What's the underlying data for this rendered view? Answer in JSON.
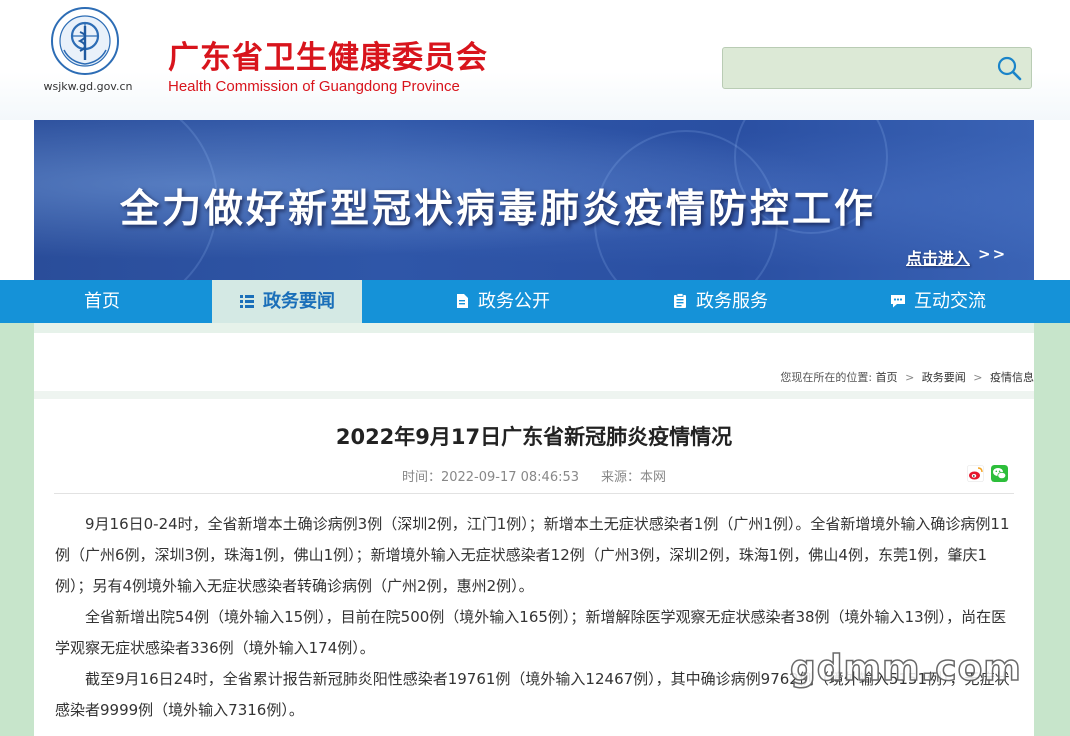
{
  "header": {
    "logo_url": "wsjkw.gd.gov.cn",
    "title_zh": "广东省卫生健康委员会",
    "title_en": "Health Commission of Guangdong Province",
    "search": {
      "placeholder": "",
      "value": ""
    }
  },
  "banner": {
    "title": "全力做好新型冠状病毒肺炎疫情防控工作",
    "link_label": "点击进入",
    "link_arrows": ">>"
  },
  "nav": {
    "items": [
      {
        "label": "首页",
        "icon": "none",
        "active": false
      },
      {
        "label": "政务要闻",
        "icon": "news-list-icon",
        "active": true
      },
      {
        "label": "政务公开",
        "icon": "document-icon",
        "active": false
      },
      {
        "label": "政务服务",
        "icon": "clipboard-icon",
        "active": false
      },
      {
        "label": "互动交流",
        "icon": "chat-icon",
        "active": false
      }
    ]
  },
  "breadcrumb": {
    "prefix": "您现在所在的位置:",
    "items": [
      "首页",
      "政务要闻",
      "疫情信息"
    ],
    "separator": ">"
  },
  "article": {
    "title": "2022年9月17日广东省新冠肺炎疫情情况",
    "time_label": "时间：",
    "time": "2022-09-17 08:46:53",
    "source_label": "来源：",
    "source": "本网",
    "paragraphs": [
      "9月16日0-24时，全省新增本土确诊病例3例（深圳2例，江门1例）；新增本土无症状感染者1例（广州1例）。全省新增境外输入确诊病例11例（广州6例，深圳3例，珠海1例，佛山1例）；新增境外输入无症状感染者12例（广州3例，深圳2例，珠海1例，佛山4例，东莞1例，肇庆1例）；另有4例境外输入无症状感染者转确诊病例（广州2例，惠州2例）。",
      "全省新增出院54例（境外输入15例），目前在院500例（境外输入165例）；新增解除医学观察无症状感染者38例（境外输入13例），尚在医学观察无症状感染者336例（境外输入174例）。",
      "截至9月16日24时，全省累计报告新冠肺炎阳性感染者19761例（境外输入12467例），其中确诊病例9762例（境外输入5151例），无症状感染者9999例（境外输入7316例）。"
    ]
  },
  "share": {
    "weibo": "weibo-icon",
    "wechat": "wechat-icon"
  },
  "watermark": "gdmm.com",
  "colors": {
    "brand_red": "#d8141c",
    "nav_blue": "#1592d8",
    "nav_active_bg": "#d4e9e4",
    "side_green": "#c7e5cb"
  }
}
